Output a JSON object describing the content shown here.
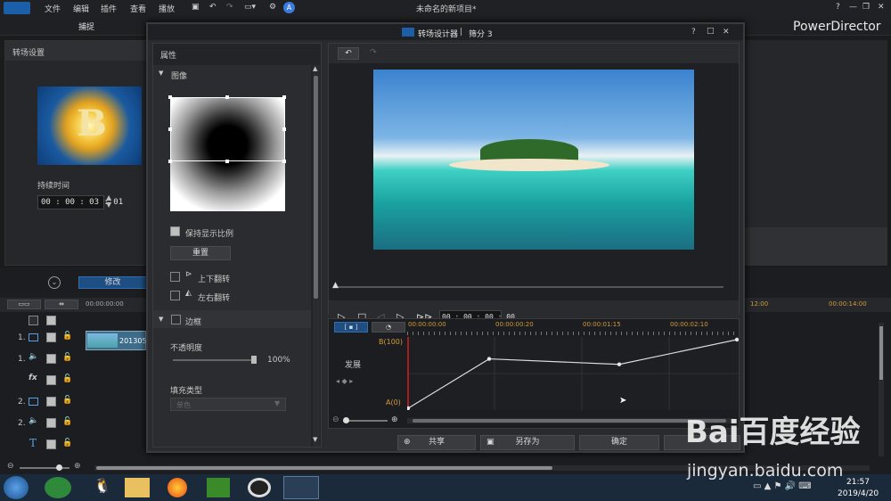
{
  "menu": {
    "items": [
      "文件",
      "编辑",
      "插件",
      "查看",
      "播放"
    ]
  },
  "window_title": "未命名的新项目*",
  "app_name": "PowerDirector",
  "capture_tab": "捕捉",
  "left_panel": {
    "title": "转场设置",
    "duration_label": "持续时间",
    "duration_value": "00 : 00 : 03 : 01",
    "thumb_letter": "B"
  },
  "edit_button": "修改",
  "timeline": {
    "ruler_left": "00:00:00:00",
    "ruler_r1": "12:00",
    "ruler_r2": "00:00:14:00",
    "clip_label": "201305",
    "tracks": [
      "1.",
      "1.",
      "",
      "2.",
      "2.",
      ""
    ]
  },
  "dialog": {
    "title": "转场设计器",
    "subtitle": "筛分 3",
    "props_title": "属性",
    "image_section": "图像",
    "keep_ratio": "保持显示比例",
    "reset": "重置",
    "flip_v": "上下翻转",
    "flip_h": "左右翻转",
    "border_section": "边框",
    "opacity_label": "不透明度",
    "opacity_value": "100%",
    "fill_type_label": "填充类型",
    "fill_type_value": "单色",
    "timecode": "00 : 00 : 00 : 00",
    "kf_times": [
      "00:00:00:00",
      "00:00:00:20",
      "00:00:01:15",
      "00:00:02:10"
    ],
    "kf_label": "发展",
    "kf_top": "B(100)",
    "kf_bottom": "A(0)",
    "share": "共享",
    "save_as": "另存为",
    "ok": "确定"
  },
  "keyframe_progress": [
    0,
    0.72,
    0.64,
    1
  ],
  "taskbar": {
    "time": "21:57",
    "date": "2019/4/20"
  },
  "watermark": {
    "text": "Bai百度经验",
    "url": "jingyan.baidu.com"
  }
}
